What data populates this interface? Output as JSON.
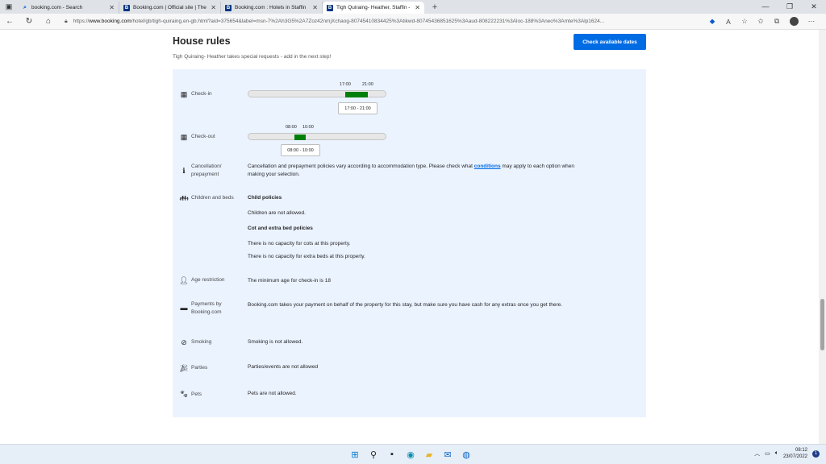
{
  "browser": {
    "tabs": [
      {
        "title": "booking.com - Search",
        "favicon": "search-icon"
      },
      {
        "title": "Booking.com | Official site | The",
        "favicon": "B"
      },
      {
        "title": "Booking.com : Hotels in Staffin",
        "favicon": "B"
      },
      {
        "title": "Tigh Quiraing- Heather, Staffin -",
        "favicon": "B",
        "active": true
      }
    ],
    "url_scheme": "https://",
    "url_host": "www.booking.com",
    "url_rest": "/hotel/gb/tigh-quiraing.en-gb.html?aid=375654&label=msn-7%2Ah3G5%2A7Zoz42nmjXchaog-80745410834425%3Atikwd-80745436851625%3Aaud-808222231%3Aloc-188%3Aneo%3Amte%3Alp1624..."
  },
  "page": {
    "title": "House rules",
    "subnote_prefix": "Tigh Quiraing- Heather takes special requests - add in the next step!",
    "check_dates_button": "Check available dates"
  },
  "rules": {
    "checkin": {
      "label": "Check-in",
      "start": "17:00",
      "end": "21:00",
      "range": "17:00 - 21:00"
    },
    "checkout": {
      "label": "Check-out",
      "start": "08:00",
      "end": "10:00",
      "range": "08:00 - 10:00"
    },
    "cancellation": {
      "label_1": "Cancellation/",
      "label_2": "prepayment",
      "text_before": "Cancellation and prepayment policies vary according to accommodation type. Please check what ",
      "link": "conditions",
      "text_after": " may apply to each option when",
      "text_line2": "making your selection."
    },
    "children": {
      "label": "Children and beds",
      "heading1": "Child policies",
      "line1": "Children are not allowed.",
      "heading2": "Cot and extra bed policies",
      "line2": "There is no capacity for cots at this property.",
      "line3": "There is no capacity for extra beds at this property."
    },
    "age": {
      "label": "Age restriction",
      "text": "The minimum age for check-in is 18"
    },
    "payments": {
      "label_1": "Payments by",
      "label_2": "Booking.com",
      "text": "Booking.com takes your payment on behalf of the property for this stay, but make sure you have cash for any extras once you get there."
    },
    "smoking": {
      "label": "Smoking",
      "text": "Smoking is not allowed."
    },
    "parties": {
      "label": "Parties",
      "text": "Parties/events are not allowed"
    },
    "pets": {
      "label": "Pets",
      "text": "Pets are not allowed."
    }
  },
  "taskbar": {
    "time": "08:12",
    "date": "23/07/2022",
    "notifications": "1"
  },
  "colors": {
    "accent": "#006ce4",
    "panel": "#ebf3ff",
    "timefill": "#008009"
  }
}
